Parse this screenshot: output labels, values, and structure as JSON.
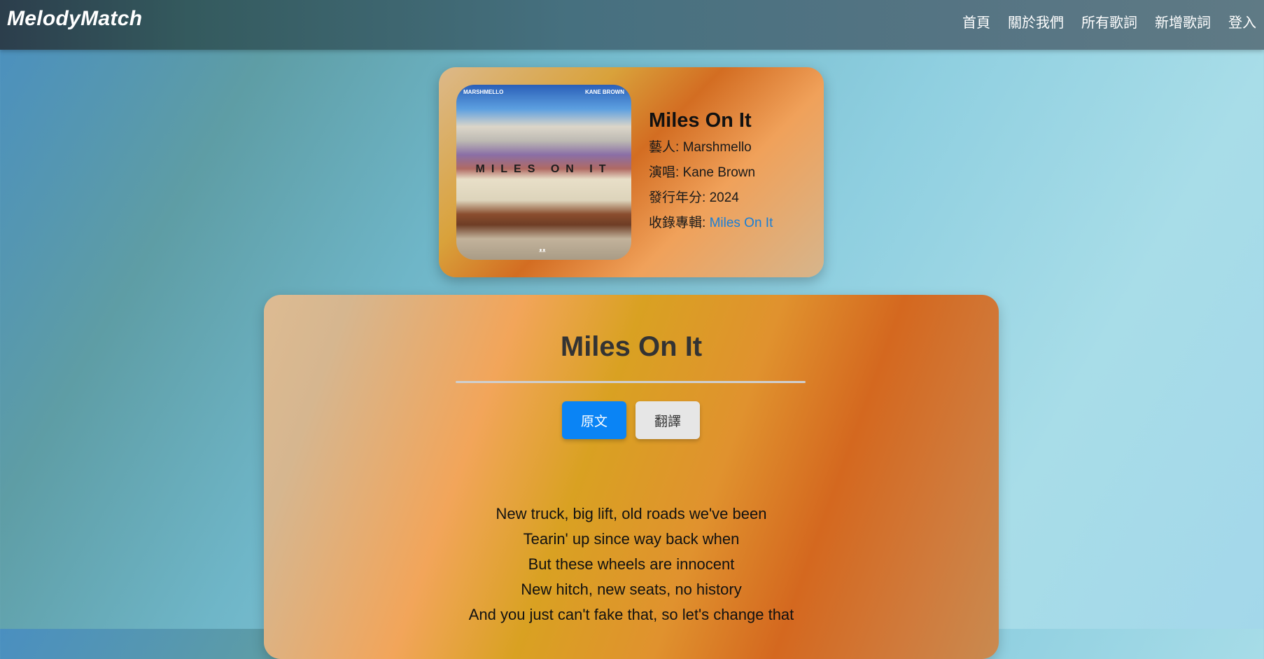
{
  "navbar": {
    "brand": "MelodyMatch",
    "links": [
      "首頁",
      "關於我們",
      "所有歌詞",
      "新增歌詞",
      "登入"
    ]
  },
  "song": {
    "title": "Miles On It",
    "artist_label": "藝人: ",
    "artist": "Marshmello",
    "singer_label": "演唱: ",
    "singer": "Kane Brown",
    "year_label": "發行年分: ",
    "year": "2024",
    "album_label": "收錄專輯: ",
    "album": "Miles On It",
    "cover": {
      "top_left": "MARSHMELLO",
      "top_right": "KANE BROWN",
      "text": "MILES ON IT",
      "mark": "ᴥᴥ"
    }
  },
  "lyrics": {
    "title": "Miles On It",
    "buttons": {
      "original": "原文",
      "translation": "翻譯"
    },
    "lines": [
      "New truck, big lift, old roads we've been",
      "Tearin' up since way back when",
      "But these wheels are innocent",
      "New hitch, new seats, no history",
      "And you just can't fake that, so let's change that"
    ]
  }
}
